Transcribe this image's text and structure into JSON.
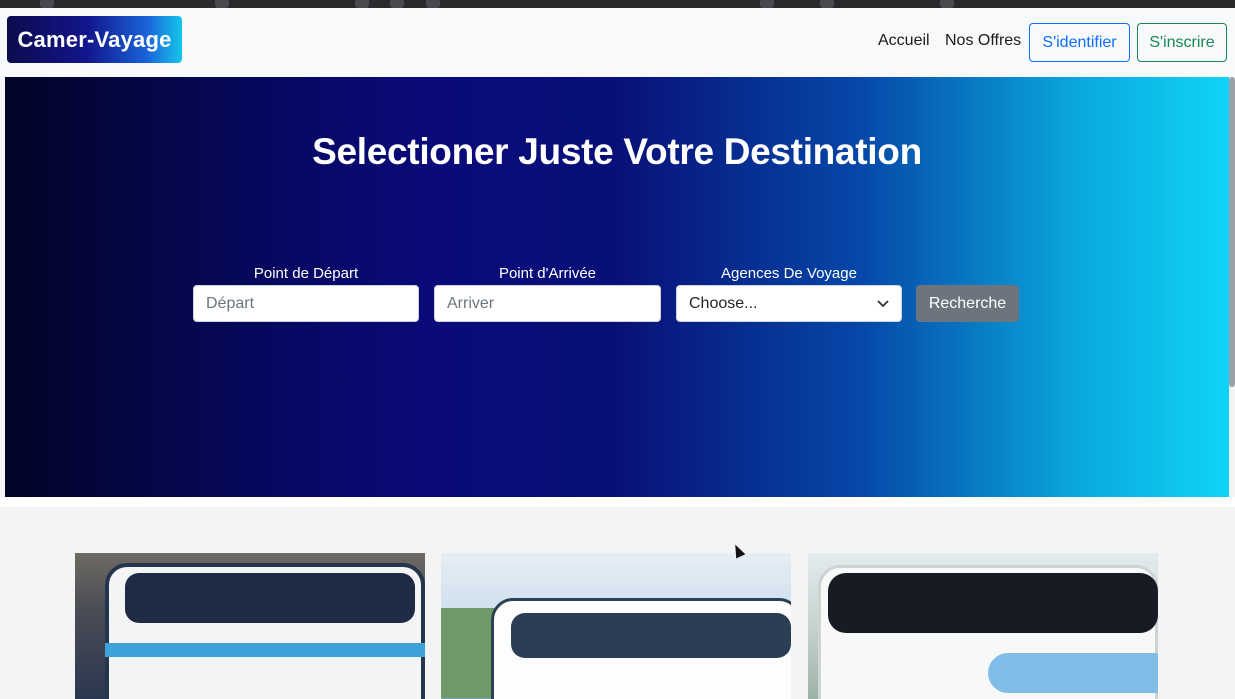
{
  "brand": {
    "name": "Camer-Vayage"
  },
  "nav": {
    "links": [
      "Accueil",
      "Nos Offres"
    ],
    "login_label": "S'identifier",
    "signup_label": "S'inscrire"
  },
  "hero": {
    "title": "Selectioner Juste Votre Destination",
    "departure": {
      "label": "Point de Départ",
      "placeholder": "Départ",
      "value": ""
    },
    "arrival": {
      "label": "Point d'Arrivée",
      "placeholder": "Arriver",
      "value": ""
    },
    "agency": {
      "label": "Agences De Voyage",
      "selected": "Choose..."
    },
    "search_label": "Recherche"
  },
  "colors": {
    "primary": "#0d6efd",
    "success": "#198754",
    "secondary": "#6c757d",
    "hero_start": "#020427",
    "hero_end": "#0fd4f7"
  },
  "icons": {
    "select": "chevron-down-icon",
    "cursor": "cursor-icon"
  },
  "cards": [
    {
      "image": "bus-photo-1"
    },
    {
      "image": "bus-photo-2"
    },
    {
      "image": "bus-photo-3"
    }
  ]
}
